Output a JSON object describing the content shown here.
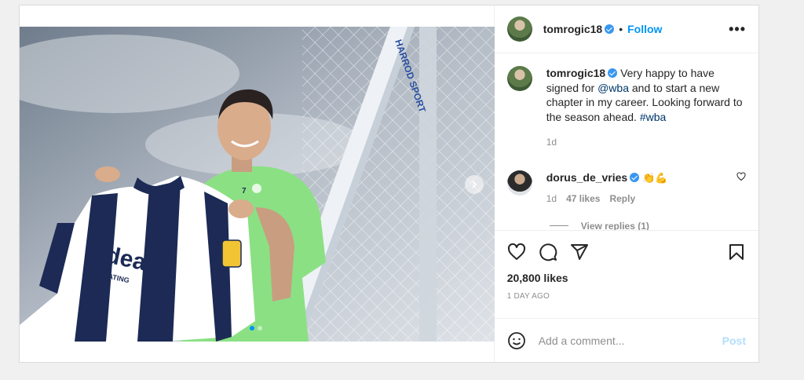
{
  "header": {
    "username": "tomrogic18",
    "separator": "•",
    "follow_label": "Follow",
    "more_label": "•••"
  },
  "caption": {
    "username": "tomrogic18",
    "text_before": " Very happy to have signed for ",
    "mention": "@wba",
    "text_middle": " and to start a new chapter in my career. Looking forward to the season ahead. ",
    "hashtag": "#wba",
    "time": "1d"
  },
  "comment": {
    "username": "dorus_de_vries",
    "emoji": "👏💪",
    "time": "1d",
    "likes": "47 likes",
    "reply_label": "Reply",
    "view_replies": "View replies (1)"
  },
  "post_meta": {
    "likes": "20,800 likes",
    "date": "1 DAY AGO"
  },
  "comment_box": {
    "placeholder": "Add a comment...",
    "post_label": "Post"
  },
  "photo": {
    "post_brand": "HARROD SPORT",
    "shirt_sponsor": "ideal",
    "shirt_sponsor_sub": "HEATING",
    "shirt_number": "7"
  },
  "carousel": {
    "slide_count": 2,
    "active_index": 0
  },
  "colors": {
    "accent": "#0095f6",
    "verified": "#3897f0",
    "shirt_navy": "#1c2a55",
    "training_top": "#8be084"
  }
}
